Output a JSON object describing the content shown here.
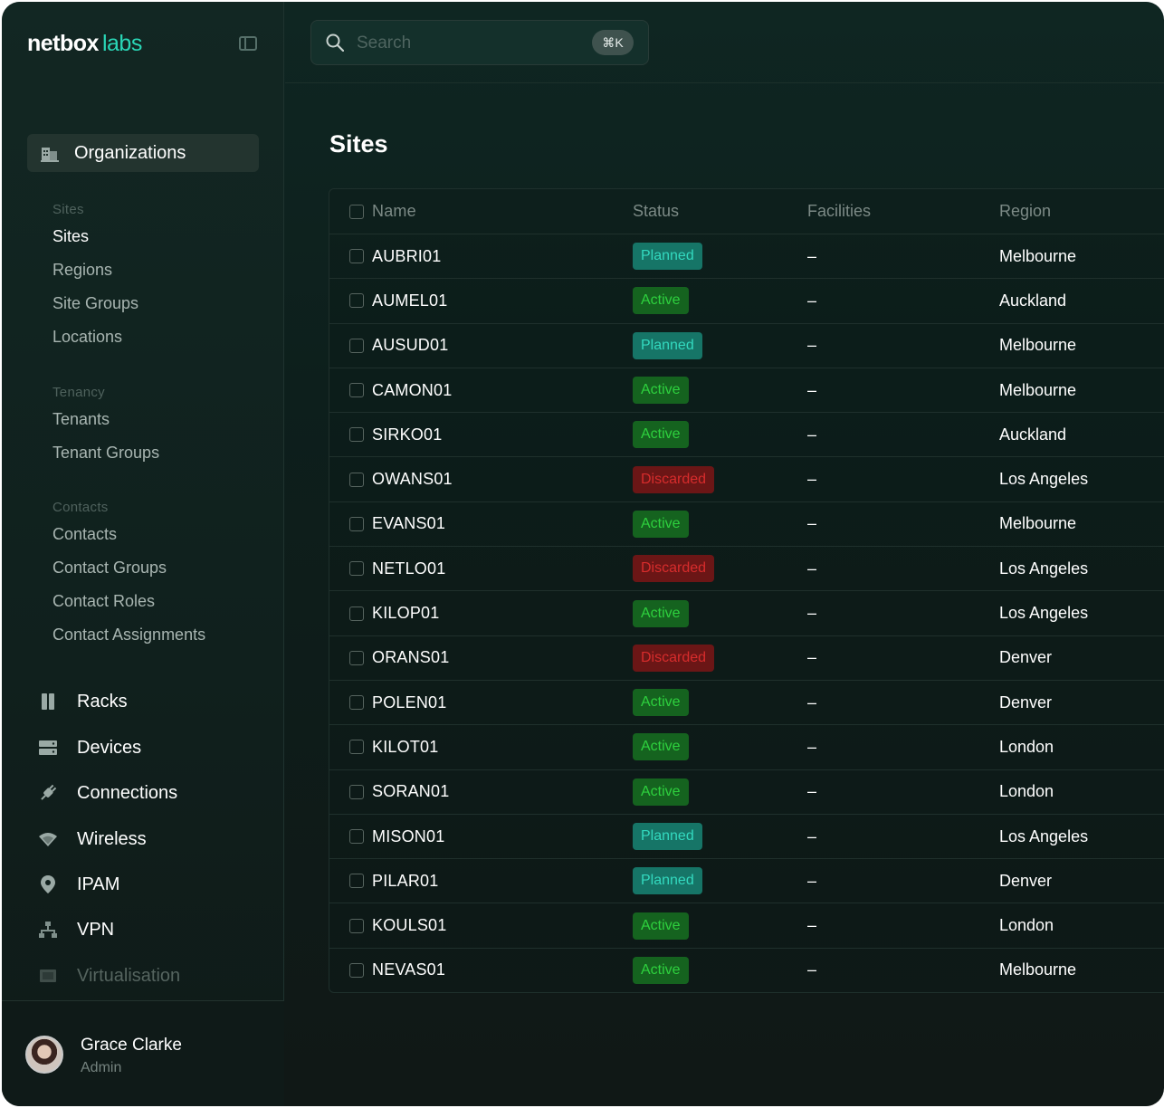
{
  "brand": {
    "name_part1": "netbox",
    "name_part2": "labs",
    "accent_color": "#2ad6b6"
  },
  "sidebar": {
    "active_section": {
      "label": "Organizations",
      "icon": "building-icon"
    },
    "groups": [
      {
        "header": "Sites",
        "links": [
          "Sites",
          "Regions",
          "Site Groups",
          "Locations"
        ]
      },
      {
        "header": "Tenancy",
        "links": [
          "Tenants",
          "Tenant Groups"
        ]
      },
      {
        "header": "Contacts",
        "links": [
          "Contacts",
          "Contact Groups",
          "Contact Roles",
          "Contact Assignments"
        ]
      }
    ],
    "active_link": "Sites",
    "nav": [
      {
        "label": "Racks",
        "icon": "rack-icon"
      },
      {
        "label": "Devices",
        "icon": "server-icon"
      },
      {
        "label": "Connections",
        "icon": "plug-icon"
      },
      {
        "label": "Wireless",
        "icon": "wifi-icon"
      },
      {
        "label": "IPAM",
        "icon": "location-pin-icon"
      },
      {
        "label": "VPN",
        "icon": "network-icon"
      },
      {
        "label": "Virtualisation",
        "icon": "chip-icon"
      }
    ],
    "user": {
      "name": "Grace Clarke",
      "role": "Admin"
    }
  },
  "search": {
    "placeholder": "Search",
    "shortcut": "⌘K"
  },
  "page": {
    "title": "Sites"
  },
  "table": {
    "columns": [
      "Name",
      "Status",
      "Facilities",
      "Region"
    ],
    "rows": [
      {
        "name": "AUBRI01",
        "status": "Planned",
        "facilities": "–",
        "region": "Melbourne"
      },
      {
        "name": "AUMEL01",
        "status": "Active",
        "facilities": "–",
        "region": "Auckland"
      },
      {
        "name": "AUSUD01",
        "status": "Planned",
        "facilities": "–",
        "region": "Melbourne"
      },
      {
        "name": "CAMON01",
        "status": "Active",
        "facilities": "–",
        "region": "Melbourne"
      },
      {
        "name": "SIRKO01",
        "status": "Active",
        "facilities": "–",
        "region": "Auckland"
      },
      {
        "name": "OWANS01",
        "status": "Discarded",
        "facilities": "–",
        "region": "Los Angeles"
      },
      {
        "name": "EVANS01",
        "status": "Active",
        "facilities": "–",
        "region": "Melbourne"
      },
      {
        "name": "NETLO01",
        "status": "Discarded",
        "facilities": "–",
        "region": "Los Angeles"
      },
      {
        "name": "KILOP01",
        "status": "Active",
        "facilities": "–",
        "region": "Los Angeles"
      },
      {
        "name": "ORANS01",
        "status": "Discarded",
        "facilities": "–",
        "region": "Denver"
      },
      {
        "name": "POLEN01",
        "status": "Active",
        "facilities": "–",
        "region": "Denver"
      },
      {
        "name": "KILOT01",
        "status": "Active",
        "facilities": "–",
        "region": "London"
      },
      {
        "name": "SORAN01",
        "status": "Active",
        "facilities": "–",
        "region": "London"
      },
      {
        "name": "MISON01",
        "status": "Planned",
        "facilities": "–",
        "region": "Los Angeles"
      },
      {
        "name": "PILAR01",
        "status": "Planned",
        "facilities": "–",
        "region": "Denver"
      },
      {
        "name": "KOULS01",
        "status": "Active",
        "facilities": "–",
        "region": "London"
      },
      {
        "name": "NEVAS01",
        "status": "Active",
        "facilities": "–",
        "region": "Melbourne"
      }
    ]
  },
  "status_colors": {
    "Planned": "#33d9bf",
    "Active": "#2ed13e",
    "Discarded": "#d72c2c"
  }
}
